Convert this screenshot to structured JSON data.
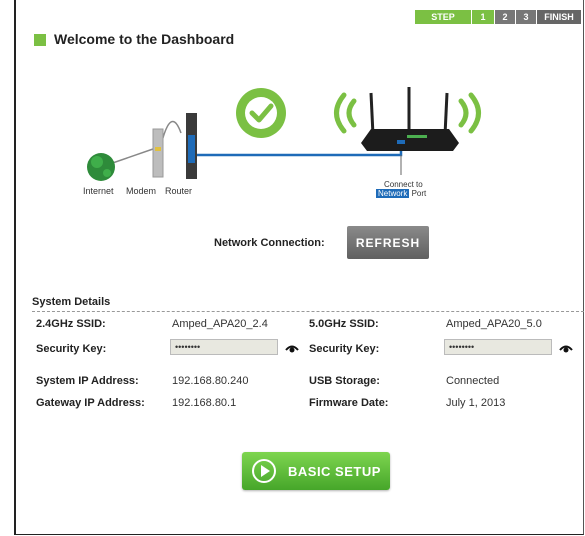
{
  "steps": {
    "step": "STEP",
    "one": "1",
    "two": "2",
    "three": "3",
    "finish": "FINISH"
  },
  "page_title": "Welcome to the Dashboard",
  "diagram": {
    "internet": "Internet",
    "modem": "Modem",
    "router": "Router",
    "connect_to": "Connect to",
    "network": "Network",
    "port": "Port"
  },
  "network_connection": {
    "label": "Network Connection:",
    "refresh": "REFRESH"
  },
  "system_details": {
    "heading": "System Details",
    "ssid24_label": "2.4GHz SSID:",
    "ssid24_value": "Amped_APA20_2.4",
    "ssid5_label": "5.0GHz SSID:",
    "ssid5_value": "Amped_APA20_5.0",
    "key_label": "Security Key:",
    "key24_value": "••••••••",
    "key5_label": "Security Key:",
    "key5_value": "••••••••",
    "sysip_label": "System IP Address:",
    "sysip_value": "192.168.80.240",
    "usb_label": "USB Storage:",
    "usb_value": "Connected",
    "gw_label": "Gateway IP Address:",
    "gw_value": "192.168.80.1",
    "fw_label": "Firmware Date:",
    "fw_value": "July 1, 2013"
  },
  "basic_setup": "BASIC SETUP",
  "colors": {
    "accent_green": "#7bc043",
    "network_blue": "#1e6bb8"
  }
}
